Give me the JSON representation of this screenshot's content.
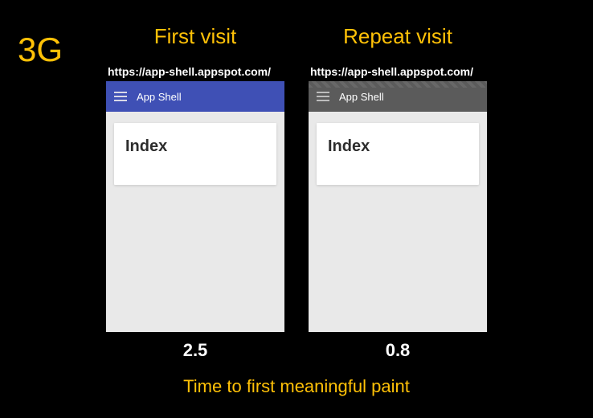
{
  "badge": "3G",
  "columns": [
    {
      "heading": "First visit",
      "url": "https://app-shell.appspot.com/",
      "app_title": "App Shell",
      "card_title": "Index",
      "time": "2.5",
      "variant": "first"
    },
    {
      "heading": "Repeat visit",
      "url": "https://app-shell.appspot.com/",
      "app_title": "App Shell",
      "card_title": "Index",
      "time": "0.8",
      "variant": "repeat"
    }
  ],
  "footer": "Time to first meaningful paint"
}
